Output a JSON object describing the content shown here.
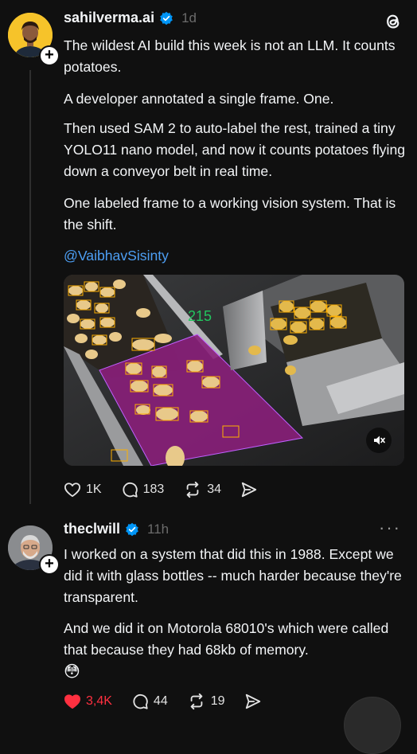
{
  "post1": {
    "username": "sahilverma.ai",
    "time": "1d",
    "paragraphs": [
      "The wildest AI build this week is not an LLM. It counts potatoes.",
      "A developer annotated a single frame. One.",
      "Then used SAM 2 to auto-label the rest, trained a tiny YOLO11 nano model, and now it counts potatoes flying down a conveyor belt in real time.",
      "One labeled frame to a working vision system. That is the shift."
    ],
    "mention": "@VaibhavSisinty",
    "video_counter": "215",
    "likes": "1K",
    "comments": "183",
    "reposts": "34"
  },
  "post2": {
    "username": "theclwill",
    "time": "11h",
    "paragraphs": [
      "I worked on a system that did this in 1988. Except we did it with glass bottles -- much harder because they're transparent.",
      "And we did it on Motorola 68010's which were called that because they had 68kb of memory."
    ],
    "emoji": "😳",
    "likes": "3,4K",
    "comments": "44",
    "reposts": "19"
  },
  "icons": {
    "post1_avatar": "avatar-icon",
    "verified": "verified-badge-icon",
    "logo": "threads-logo-icon",
    "like": "heart-icon",
    "comment": "comment-icon",
    "repost": "repost-icon",
    "share": "share-icon",
    "mute": "mute-icon"
  },
  "colors": {
    "background": "#101010",
    "link": "#4d9ff4",
    "verified": "#0095f6",
    "liked": "#ff3040",
    "detection_box": "#ffb000",
    "counter": "#22c55e"
  }
}
